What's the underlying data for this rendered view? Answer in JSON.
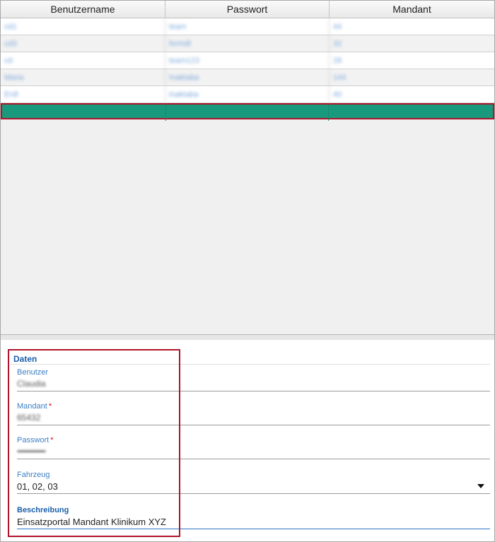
{
  "grid": {
    "columns": [
      "Benutzername",
      "Passwort",
      "Mandant"
    ],
    "rows": [
      [
        "cd1",
        "team",
        "44"
      ],
      [
        "cd3",
        "formdl",
        "32"
      ],
      [
        "cd",
        "team123",
        "28"
      ],
      [
        "Maria",
        "Inaktaba",
        "144"
      ],
      [
        "Erdl",
        "inaktaba",
        "40"
      ]
    ],
    "selected_row": [
      "",
      "",
      ""
    ]
  },
  "form": {
    "section_title": "Daten",
    "benutzer": {
      "label": "Benutzer",
      "value": "Claudia"
    },
    "mandant": {
      "label": "Mandant",
      "required_mark": "*",
      "value": "65432"
    },
    "passwort": {
      "label": "Passwort",
      "required_mark": "*",
      "value": "••••••••••••••••"
    },
    "fahrzeug": {
      "label": "Fahrzeug",
      "value": "01, 02, 03"
    },
    "beschreibung": {
      "label": "Beschreibung",
      "value": "Einsatzportal Mandant Klinikum XYZ"
    }
  },
  "colors": {
    "selected_row": "#1a9a7c",
    "highlight_border": "#b0132a",
    "label_blue": "#3d7fc4"
  },
  "icons": {
    "fahrzeug_dropdown": "chevron-down-icon"
  }
}
